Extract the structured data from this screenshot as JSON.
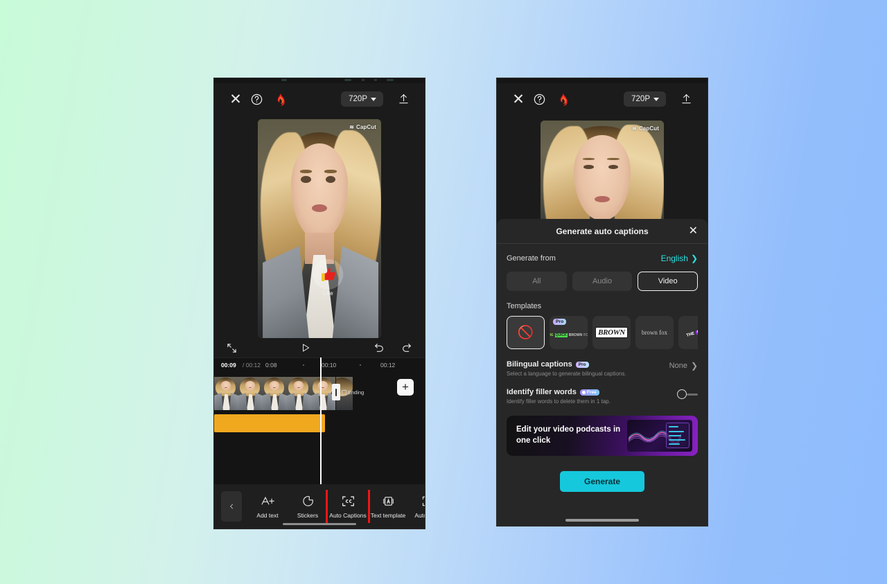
{
  "background": {
    "from": "#c8fbd8",
    "to": "#8fbcfd"
  },
  "left_phone": {
    "topbar": {
      "close_icon": "close-icon",
      "help_icon": "help-circle-icon",
      "flame_icon": "flame-icon",
      "resolution": "720P",
      "export_icon": "upload-icon"
    },
    "preview": {
      "watermark": "CapCut",
      "like_label": "Like"
    },
    "controls": {
      "fullscreen_icon": "fullscreen-icon",
      "play_icon": "play-icon",
      "undo_icon": "undo-icon",
      "redo_icon": "redo-icon"
    },
    "timeline": {
      "current_time": "00:09",
      "total_time": "/ 00:12",
      "ruler_labels": [
        "0:08",
        "00:10",
        "00:12"
      ],
      "ending_label": "Ending",
      "add_label": "+"
    },
    "toolbar": {
      "back_icon": "chevron-left-icon",
      "tools": [
        {
          "label": "Add text",
          "icon": "add-text-icon"
        },
        {
          "label": "Stickers",
          "icon": "stickers-icon"
        },
        {
          "label": "Auto Captions",
          "icon": "auto-captions-icon",
          "highlighted": true
        },
        {
          "label": "Text template",
          "icon": "text-template-icon"
        },
        {
          "label": "Auto lyrics",
          "icon": "auto-lyrics-icon"
        }
      ]
    }
  },
  "right_phone": {
    "topbar": {
      "close_icon": "close-icon",
      "help_icon": "help-circle-icon",
      "flame_icon": "flame-icon",
      "resolution": "720P",
      "export_icon": "upload-icon"
    },
    "preview": {
      "watermark": "CapCut"
    },
    "sheet": {
      "title": "Generate auto captions",
      "close_icon": "close-icon",
      "generate_from_label": "Generate from",
      "language": "English",
      "segments": [
        {
          "label": "All",
          "active": false
        },
        {
          "label": "Audio",
          "active": false
        },
        {
          "label": "Video",
          "active": true
        }
      ],
      "templates_label": "Templates",
      "templates": [
        {
          "id": "none",
          "kind": "none",
          "selected": true
        },
        {
          "id": "quick-brown-fox",
          "kind": "quick",
          "badge": "Pro",
          "text": "THE QUICK BROWN FOX"
        },
        {
          "id": "brown-bold",
          "kind": "brown",
          "text": "BROWN"
        },
        {
          "id": "brown-fox-serif",
          "kind": "serif",
          "text": "brown fox"
        },
        {
          "id": "the-quick-tilt",
          "kind": "tilt",
          "text": "THE QUICK"
        }
      ],
      "bilingual": {
        "title": "Bilingual captions",
        "badge": "Pro",
        "subtitle": "Select a language to generate bilingual captions.",
        "value": "None"
      },
      "filler": {
        "title": "Identify filler words",
        "badge": "Free",
        "subtitle": "Identify filler words to delete them in 1 tap.",
        "enabled": false
      },
      "promo": {
        "text": "Edit your video podcasts in one click"
      },
      "generate_button": "Generate"
    }
  }
}
